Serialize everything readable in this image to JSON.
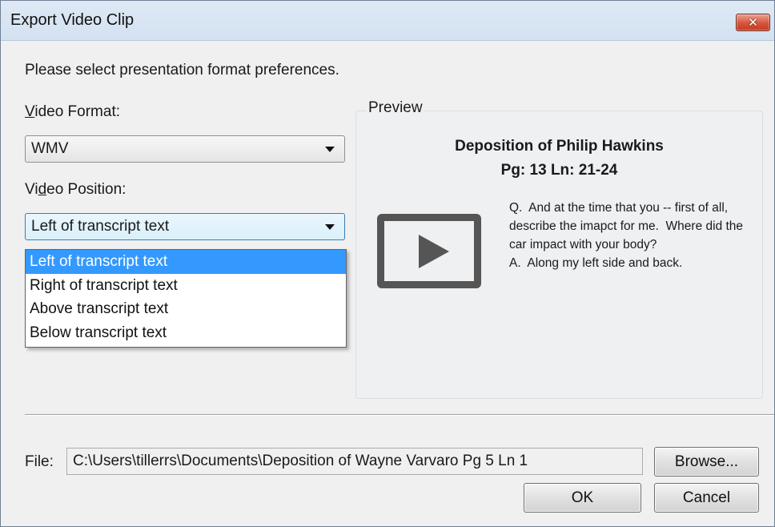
{
  "window": {
    "title": "Export Video Clip",
    "close_label": "✕"
  },
  "instruction": "Please select presentation format preferences.",
  "video_format": {
    "label_accel": "V",
    "label_rest": "ideo Format:",
    "value": "WMV"
  },
  "video_position": {
    "label_pre": "Vi",
    "label_accel": "d",
    "label_rest": "eo Position:",
    "value": "Left of transcript text",
    "options": [
      {
        "label": "Left of transcript text",
        "selected": true
      },
      {
        "label": "Right of transcript text",
        "selected": false
      },
      {
        "label": "Above transcript text",
        "selected": false
      },
      {
        "label": "Below transcript text",
        "selected": false
      }
    ]
  },
  "preview": {
    "legend": "Preview",
    "title": "Deposition of Philip Hawkins",
    "subtitle": "Pg: 13 Ln: 21-24",
    "transcript": "Q.  And at the time that you -- first of all, describe the imapct for me.  Where did the car impact with your body?\nA.  Along my left side and back.",
    "icon": "play-icon"
  },
  "file": {
    "label": "File:",
    "value": "C:\\Users\\tillerrs\\Documents\\Deposition of Wayne Varvaro Pg 5 Ln 1",
    "browse_label": "Browse..."
  },
  "buttons": {
    "ok": "OK",
    "cancel": "Cancel"
  },
  "colors": {
    "selection": "#3399ff",
    "close_button": "#d4553b"
  }
}
